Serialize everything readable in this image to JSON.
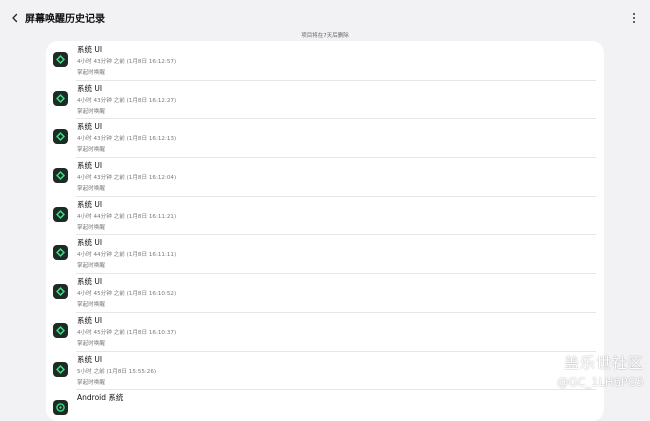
{
  "header": {
    "title": "屏幕唤醒历史记录",
    "back_icon": "chevron-left-icon",
    "more_icon": "more-vertical-icon"
  },
  "notice": "项目将在7天后删除",
  "colors": {
    "background": "#f2f2f5",
    "card": "#ffffff",
    "icon_background": "#1e2a24",
    "icon_accent": "#3ddc84",
    "secondary_text": "#777777"
  },
  "items": [
    {
      "app": "系统 UI",
      "time": "4小时 43分钟 之前 (1月8日 16:12:57)",
      "reason": "掌起时唤醒"
    },
    {
      "app": "系统 UI",
      "time": "4小时 43分钟 之前 (1月8日 16:12:27)",
      "reason": "掌起时唤醒"
    },
    {
      "app": "系统 UI",
      "time": "4小时 43分钟 之前 (1月8日 16:12:13)",
      "reason": "掌起时唤醒"
    },
    {
      "app": "系统 UI",
      "time": "4小时 43分钟 之前 (1月8日 16:12:04)",
      "reason": "掌起时唤醒"
    },
    {
      "app": "系统 UI",
      "time": "4小时 44分钟 之前 (1月8日 16:11:21)",
      "reason": "掌起时唤醒"
    },
    {
      "app": "系统 UI",
      "time": "4小时 44分钟 之前 (1月8日 16:11:11)",
      "reason": "掌起时唤醒"
    },
    {
      "app": "系统 UI",
      "time": "4小时 45分钟 之前 (1月8日 16:10:52)",
      "reason": "掌起时唤醒"
    },
    {
      "app": "系统 UI",
      "time": "4小时 45分钟 之前 (1月8日 16:10:37)",
      "reason": "掌起时唤醒"
    },
    {
      "app": "系统 UI",
      "time": "5小时 之前 (1月8日 15:55:26)",
      "reason": "掌起时唤醒"
    },
    {
      "app": "Android 系统",
      "time": "",
      "reason": ""
    }
  ],
  "watermark": {
    "title": "盖乐世社区",
    "user": "@GC_1LH6PG5"
  }
}
